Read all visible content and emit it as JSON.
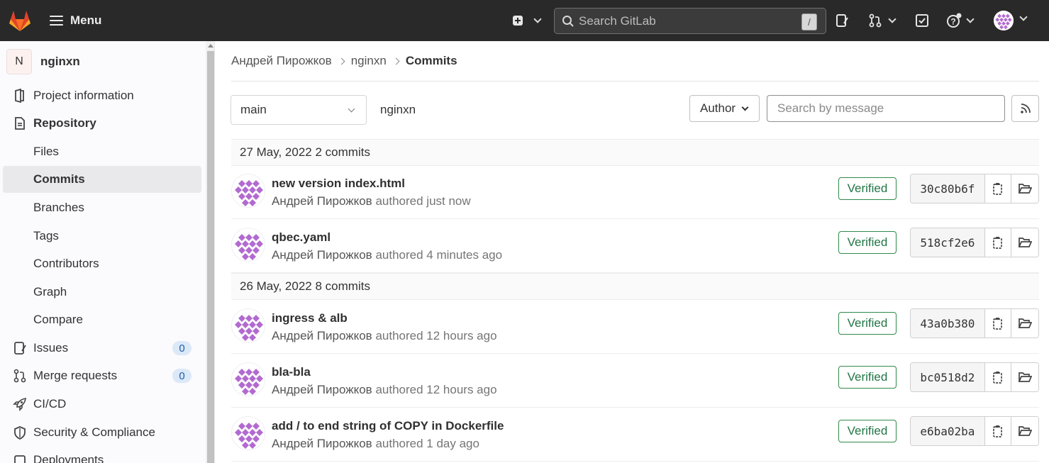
{
  "topbar": {
    "menu_label": "Menu",
    "search_placeholder": "Search GitLab",
    "search_shortcut": "/"
  },
  "sidebar": {
    "project_initial": "N",
    "project_name": "nginxn",
    "items": [
      {
        "label": "Project information",
        "icon": "project-info-icon"
      },
      {
        "label": "Repository",
        "icon": "repository-icon"
      },
      {
        "label": "Files"
      },
      {
        "label": "Commits",
        "active": true
      },
      {
        "label": "Branches"
      },
      {
        "label": "Tags"
      },
      {
        "label": "Contributors"
      },
      {
        "label": "Graph"
      },
      {
        "label": "Compare"
      },
      {
        "label": "Issues",
        "icon": "issues-icon",
        "count": "0"
      },
      {
        "label": "Merge requests",
        "icon": "merge-request-icon",
        "count": "0"
      },
      {
        "label": "CI/CD",
        "icon": "rocket-icon"
      },
      {
        "label": "Security & Compliance",
        "icon": "shield-icon"
      },
      {
        "label": "Deployments",
        "icon": "deployments-icon"
      }
    ]
  },
  "breadcrumb": {
    "user": "Андрей Пирожков",
    "project": "nginxn",
    "current": "Commits"
  },
  "filters": {
    "branch": "main",
    "path": "nginxn",
    "author_label": "Author",
    "search_placeholder": "Search by message"
  },
  "days": [
    {
      "date": "27 May, 2022",
      "count_text": "2 commits"
    },
    {
      "date": "26 May, 2022",
      "count_text": "8 commits"
    }
  ],
  "commits": [
    {
      "title": "new version index.html",
      "author": "Андрей Пирожков",
      "authored": "authored",
      "time": "just now",
      "verified": "Verified",
      "sha": "30c80b6f"
    },
    {
      "title": "qbec.yaml",
      "author": "Андрей Пирожков",
      "authored": "authored",
      "time": "4 minutes ago",
      "verified": "Verified",
      "sha": "518cf2e6"
    },
    {
      "title": "ingress & alb",
      "author": "Андрей Пирожков",
      "authored": "authored",
      "time": "12 hours ago",
      "verified": "Verified",
      "sha": "43a0b380"
    },
    {
      "title": "bla-bla",
      "author": "Андрей Пирожков",
      "authored": "authored",
      "time": "12 hours ago",
      "verified": "Verified",
      "sha": "bc0518d2"
    },
    {
      "title": "add / to end string of COPY in Dockerfile",
      "author": "Андрей Пирожков",
      "authored": "authored",
      "time": "1 day ago",
      "verified": "Verified",
      "sha": "e6ba02ba"
    }
  ],
  "colors": {
    "navbar": "#292929",
    "accent_verified": "#217645",
    "avatar_purple": "#a25fc9"
  }
}
